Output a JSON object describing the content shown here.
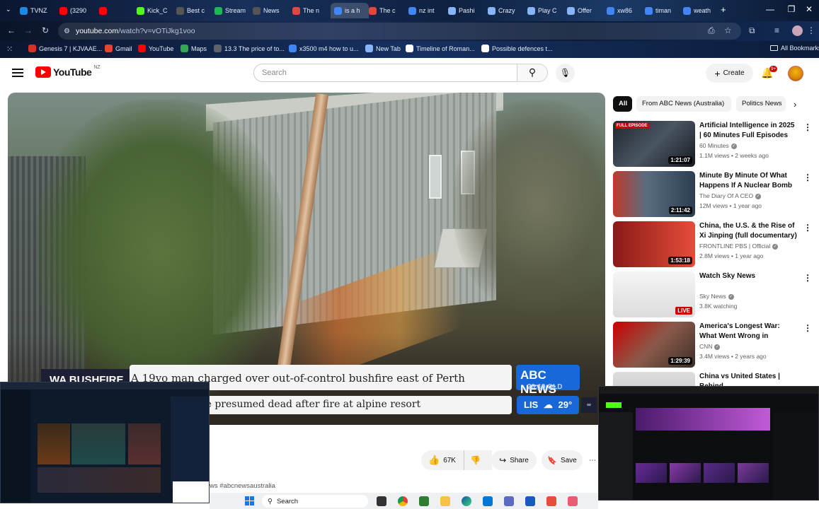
{
  "browser": {
    "tabs": [
      {
        "label": "TVNZ",
        "color": "#1e88e5",
        "icon": "plus-icon"
      },
      {
        "label": "(3290",
        "color": "#ff0000",
        "icon": "youtube-icon"
      },
      {
        "label": "",
        "color": "#ff0000",
        "icon": "youtube-icon"
      },
      {
        "label": "Kick_C",
        "color": "#53fc18",
        "icon": "kick-icon"
      },
      {
        "label": "Best c",
        "color": "#555555",
        "icon": "page-icon"
      },
      {
        "label": "Stream",
        "color": "#1db954",
        "icon": "stream-icon"
      },
      {
        "label": "News",
        "color": "#555555",
        "icon": "page-icon"
      },
      {
        "label": "The n",
        "color": "#e0483e",
        "icon": "page-icon"
      },
      {
        "label": "is a h",
        "color": "#4285f4",
        "icon": "google-icon"
      },
      {
        "label": "The c",
        "color": "#e0483e",
        "icon": "page-icon"
      },
      {
        "label": "nz int",
        "color": "#4285f4",
        "icon": "google-icon"
      },
      {
        "label": "Pashi",
        "color": "#8ab4f8",
        "icon": "page-icon"
      },
      {
        "label": "Crazy",
        "color": "#8ab4f8",
        "icon": "page-icon"
      },
      {
        "label": "Play C",
        "color": "#8ab4f8",
        "icon": "page-icon"
      },
      {
        "label": "Offer",
        "color": "#8ab4f8",
        "icon": "page-icon"
      },
      {
        "label": "xw86",
        "color": "#4285f4",
        "icon": "google-icon"
      },
      {
        "label": "timan",
        "color": "#4285f4",
        "icon": "google-icon"
      },
      {
        "label": "weath",
        "color": "#4285f4",
        "icon": "google-icon"
      }
    ],
    "url_domain": "youtube.com",
    "url_path": "/watch?v=vOTiJkg1voo",
    "bookmarks": [
      {
        "label": "Genesis 7 | KJVAAE...",
        "color": "#d93025"
      },
      {
        "label": "Gmail",
        "color": "#ea4335"
      },
      {
        "label": "YouTube",
        "color": "#ff0000"
      },
      {
        "label": "Maps",
        "color": "#34a853"
      },
      {
        "label": "13.3 The price of to...",
        "color": "#5f6368"
      },
      {
        "label": "x3500 m4 how to u...",
        "color": "#4285f4"
      },
      {
        "label": "New Tab",
        "color": "#8ab4f8"
      },
      {
        "label": "Timeline of Roman...",
        "color": "#ffffff"
      },
      {
        "label": "Possible defences t...",
        "color": "#ffffff"
      }
    ],
    "all_bookmarks": "All Bookmarks"
  },
  "youtube": {
    "logo_text": "YouTube",
    "country_code": "NZ",
    "search_placeholder": "Search",
    "create_label": "Create",
    "notification_count": "9+"
  },
  "video": {
    "lower_third_tag": "WA BUSHFIRE",
    "headline_1": "A 19yo man charged over out-of-control bushfire east of Perth",
    "headline_2": "ns of people are presumed dead after fire at alpine resort",
    "channel_bug": "ABC NEWS",
    "time_text": "20:19 QLD",
    "weather_city": "LIS",
    "weather_temp": "29°",
    "like_count": "67K",
    "share_label": "Share",
    "save_label": "Save",
    "hashtags_text": "ws #abcnewsaustralia"
  },
  "sidebar": {
    "chips": [
      "All",
      "From ABC News (Australia)",
      "Politics News"
    ],
    "items": [
      {
        "title": "Artificial Intelligence in 2025 | 60 Minutes Full Episodes",
        "channel": "60 Minutes",
        "meta": "1.1M views • 2 weeks ago",
        "duration": "1:21:07",
        "badge": "FULL EPISODE",
        "bg": "linear-gradient(135deg,#20262e,#4a5563 50%,#161a20)"
      },
      {
        "title": "Minute By Minute Of What Happens If A Nuclear Bomb ...",
        "channel": "The Diary Of A CEO",
        "meta": "12M views • 1 year ago",
        "duration": "2:11:42",
        "badge": "",
        "bg": "linear-gradient(90deg,#c0392b 0%,#5a6d80 40%,#2c3e50 100%)"
      },
      {
        "title": "China, the U.S. & the Rise of Xi Jinping (full documentary) | ...",
        "channel": "FRONTLINE PBS | Official",
        "meta": "2.8M views • 1 year ago",
        "duration": "1:53:18",
        "badge": "",
        "bg": "linear-gradient(90deg,#8b1a1a,#c0392b 60%,#e74c3c)"
      },
      {
        "title": "Watch Sky News",
        "channel": "Sky News",
        "meta": "3.8K watching",
        "duration": "LIVE",
        "badge": "",
        "bg": "linear-gradient(180deg,#f5f5f5,#dcdcdc)"
      },
      {
        "title": "America's Longest War: What Went Wrong in Afghanistan ...",
        "channel": "CNN",
        "meta": "3.4M views • 2 years ago",
        "duration": "1:29:39",
        "badge": "",
        "bg": "linear-gradient(135deg,#cc0000,#8a5a4a 50%,#3b2e28)"
      },
      {
        "title": "China vs United States | Behind",
        "channel": "",
        "meta": "",
        "duration": "",
        "badge": "",
        "bg": "linear-gradient(180deg,#ddd,#bbb)"
      }
    ]
  },
  "taskbar": {
    "search_label": "Search"
  }
}
